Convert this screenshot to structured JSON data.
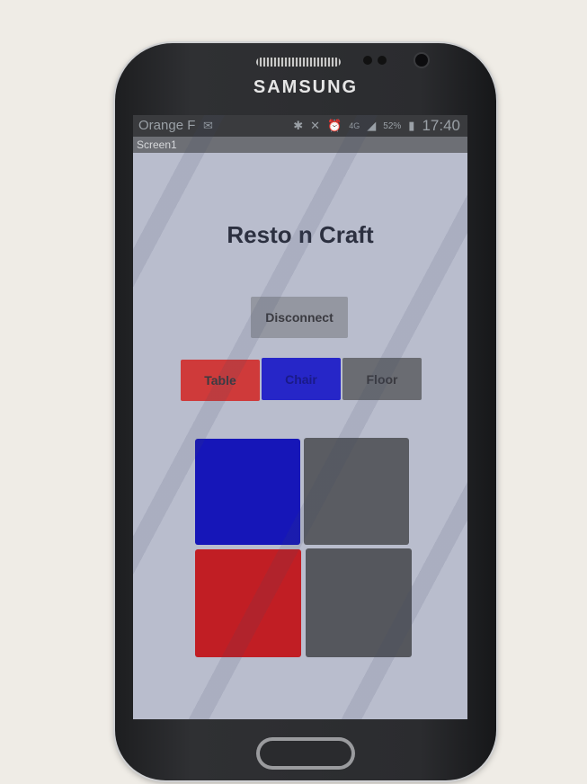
{
  "device": {
    "brand": "SAMSUNG"
  },
  "status_bar": {
    "carrier": "Orange F",
    "network": "4G",
    "battery": "52%",
    "time": "17:40",
    "icons": [
      "message-icon",
      "bluetooth-icon",
      "mute-icon",
      "alarm-icon",
      "signal-icon",
      "battery-icon"
    ]
  },
  "screen": {
    "name": "Screen1"
  },
  "app": {
    "title": "Resto n Craft",
    "disconnect_label": "Disconnect",
    "buttons": [
      {
        "label": "Table",
        "color": "#cf3a3a"
      },
      {
        "label": "Chair",
        "color": "#2626c8"
      },
      {
        "label": "Floor",
        "color": "#6a6c72"
      }
    ],
    "tiles": [
      {
        "color": "#1616b8"
      },
      {
        "color": "#5a5c62"
      },
      {
        "color": "#c11e24"
      },
      {
        "color": "#55575d"
      }
    ]
  }
}
